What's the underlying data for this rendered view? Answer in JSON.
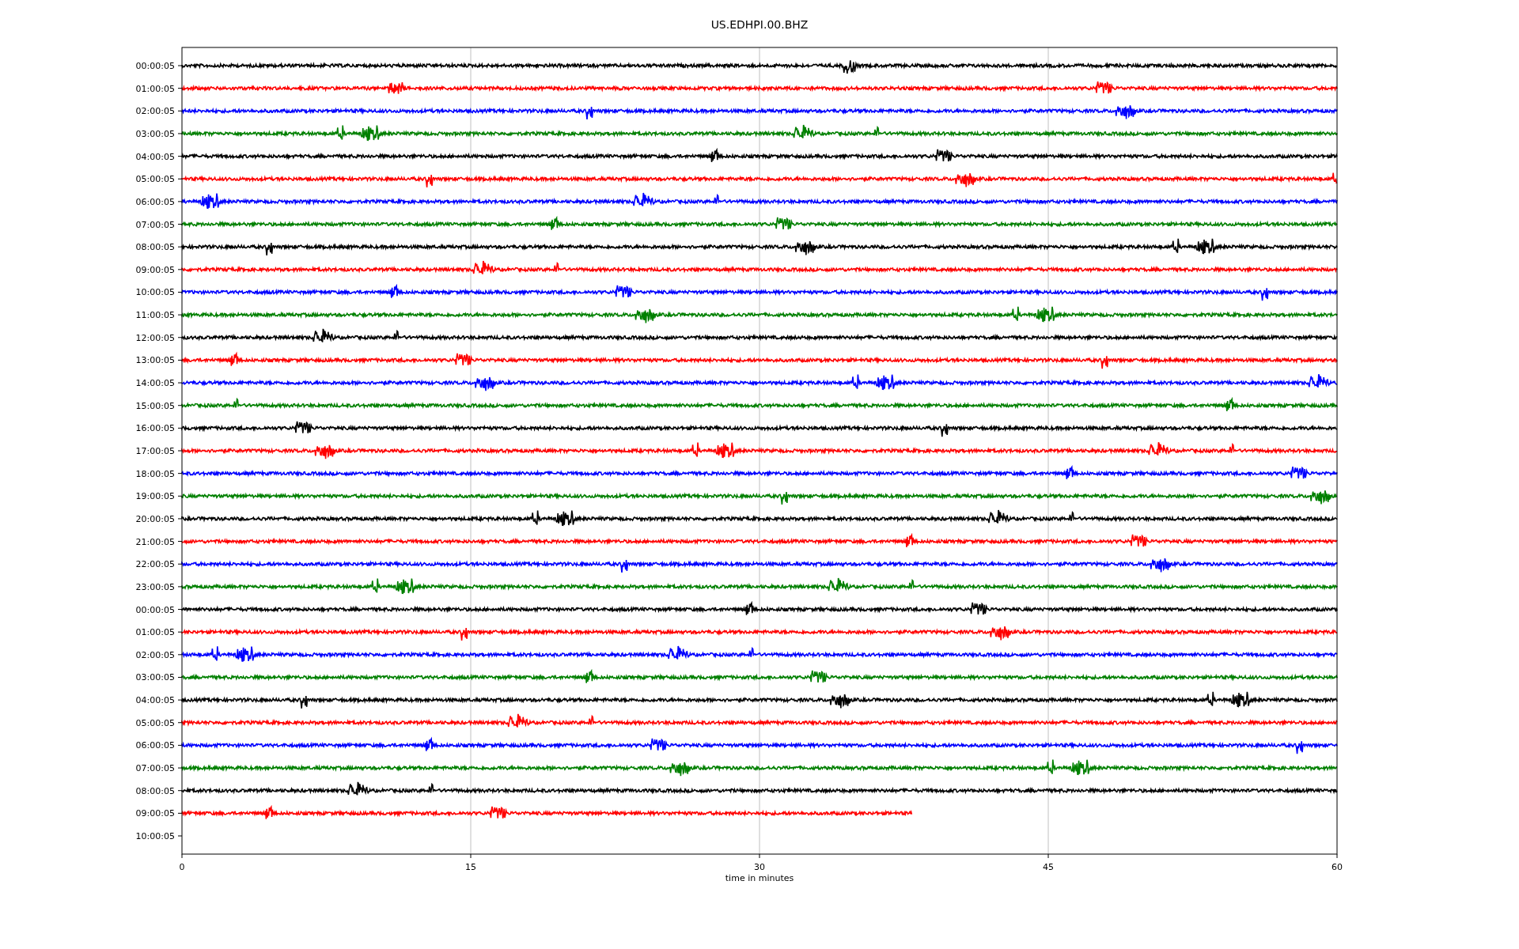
{
  "title": "US.EDHPI.00.BHZ",
  "xlabel": "time in minutes",
  "xticks": [
    "0",
    "15",
    "30",
    "45",
    "60"
  ],
  "rows": [
    {
      "label": "00:00:05",
      "color": "#000000",
      "level": 1
    },
    {
      "label": "01:00:05",
      "color": "#ff0000",
      "level": 1
    },
    {
      "label": "02:00:05",
      "color": "#0000ff",
      "level": 1
    },
    {
      "label": "03:00:05",
      "color": "#008000",
      "level": 1
    },
    {
      "label": "04:00:05",
      "color": "#000000",
      "level": 1
    },
    {
      "label": "05:00:05",
      "color": "#ff0000",
      "level": 1
    },
    {
      "label": "06:00:05",
      "color": "#0000ff",
      "level": 1
    },
    {
      "label": "07:00:05",
      "color": "#008000",
      "level": 1
    },
    {
      "label": "08:00:05",
      "color": "#000000",
      "level": 1
    },
    {
      "label": "09:00:05",
      "color": "#ff0000",
      "level": 1
    },
    {
      "label": "10:00:05",
      "color": "#0000ff",
      "level": 1
    },
    {
      "label": "11:00:05",
      "color": "#008000",
      "level": 1
    },
    {
      "label": "12:00:05",
      "color": "#000000",
      "level": 1
    },
    {
      "label": "13:00:05",
      "color": "#ff0000",
      "level": 1
    },
    {
      "label": "14:00:05",
      "color": "#0000ff",
      "level": 1
    },
    {
      "label": "15:00:05",
      "color": "#008000",
      "level": 1
    },
    {
      "label": "16:00:05",
      "color": "#000000",
      "level": 1
    },
    {
      "label": "17:00:05",
      "color": "#ff0000",
      "level": 1
    },
    {
      "label": "18:00:05",
      "color": "#0000ff",
      "level": 1
    },
    {
      "label": "19:00:05",
      "color": "#008000",
      "level": 1
    },
    {
      "label": "20:00:05",
      "color": "#000000",
      "level": 1
    },
    {
      "label": "21:00:05",
      "color": "#ff0000",
      "level": 1
    },
    {
      "label": "22:00:05",
      "color": "#0000ff",
      "level": 1
    },
    {
      "label": "23:00:05",
      "color": "#008000",
      "level": 1
    },
    {
      "label": "00:00:05",
      "color": "#000000",
      "level": 1
    },
    {
      "label": "01:00:05",
      "color": "#ff0000",
      "level": 1
    },
    {
      "label": "02:00:05",
      "color": "#0000ff",
      "level": 1
    },
    {
      "label": "03:00:05",
      "color": "#008000",
      "level": 1
    },
    {
      "label": "04:00:05",
      "color": "#000000",
      "level": 1
    },
    {
      "label": "05:00:05",
      "color": "#ff0000",
      "level": 1
    },
    {
      "label": "06:00:05",
      "color": "#0000ff",
      "level": 1
    },
    {
      "label": "07:00:05",
      "color": "#008000",
      "level": 1
    },
    {
      "label": "08:00:05",
      "color": "#000000",
      "level": 1
    },
    {
      "label": "09:00:05",
      "color": "#ff0000",
      "level": 0.632
    },
    {
      "label": "10:00:05"
    }
  ]
}
